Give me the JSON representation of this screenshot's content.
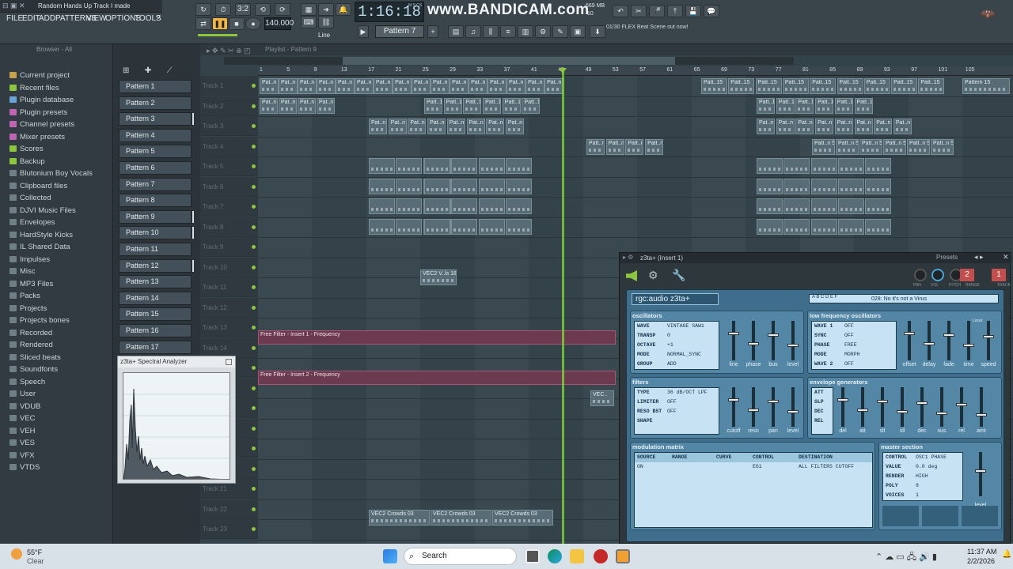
{
  "window": {
    "title": "Random Hands Up Track I made"
  },
  "menu": [
    "FILE",
    "EDIT",
    "ADD",
    "PATTERNS",
    "VIEW",
    "OPTIONS",
    "TOOLS",
    "?"
  ],
  "transport": {
    "time": "1:16:18",
    "time_unit": "M:S:CS",
    "tempo": "140.000",
    "snap": "Line",
    "pattern": "Pattern 7",
    "cpu": "669 MB",
    "cpu2": "10"
  },
  "watermark": "www.BANDICAM.com",
  "hint": {
    "count": "01/30",
    "text": "FLEX Beat Scene out now!"
  },
  "browser": {
    "header": "Browser - All",
    "items": [
      {
        "label": "Current project",
        "color": "#c9a04a"
      },
      {
        "label": "Recent files",
        "color": "#8cc63f"
      },
      {
        "label": "Plugin database",
        "color": "#6aa3d6"
      },
      {
        "label": "Plugin presets",
        "color": "#c064b4"
      },
      {
        "label": "Channel presets",
        "color": "#c064b4"
      },
      {
        "label": "Mixer presets",
        "color": "#c064b4"
      },
      {
        "label": "Scores",
        "color": "#8cc63f"
      },
      {
        "label": "Backup",
        "color": "#8cc63f"
      },
      {
        "label": "Blutonium Boy Vocals",
        "color": "#6f7f88"
      },
      {
        "label": "Clipboard files",
        "color": "#6f7f88"
      },
      {
        "label": "Collected",
        "color": "#6f7f88"
      },
      {
        "label": "DJVI Music Files",
        "color": "#6f7f88"
      },
      {
        "label": "Envelopes",
        "color": "#6f7f88"
      },
      {
        "label": "HardStyle Kicks",
        "color": "#6f7f88"
      },
      {
        "label": "IL Shared Data",
        "color": "#6f7f88"
      },
      {
        "label": "Impulses",
        "color": "#6f7f88"
      },
      {
        "label": "Misc",
        "color": "#6f7f88"
      },
      {
        "label": "MP3 Files",
        "color": "#6f7f88"
      },
      {
        "label": "Packs",
        "color": "#6f7f88"
      },
      {
        "label": "Projects",
        "color": "#6f7f88"
      },
      {
        "label": "Projects bones",
        "color": "#6f7f88"
      },
      {
        "label": "Recorded",
        "color": "#6f7f88"
      },
      {
        "label": "Rendered",
        "color": "#6f7f88"
      },
      {
        "label": "Sliced beats",
        "color": "#6f7f88"
      },
      {
        "label": "Soundfonts",
        "color": "#6f7f88"
      },
      {
        "label": "Speech",
        "color": "#6f7f88"
      },
      {
        "label": "User",
        "color": "#6f7f88"
      },
      {
        "label": "VDUB",
        "color": "#6f7f88"
      },
      {
        "label": "VEC",
        "color": "#6f7f88"
      },
      {
        "label": "VEH",
        "color": "#6f7f88"
      },
      {
        "label": "VES",
        "color": "#6f7f88"
      },
      {
        "label": "VFX",
        "color": "#6f7f88"
      },
      {
        "label": "VTDS",
        "color": "#6f7f88"
      }
    ]
  },
  "patterns": [
    "Pattern 1",
    "Pattern 2",
    "Pattern 3",
    "Pattern 4",
    "Pattern 5",
    "Pattern 6",
    "Pattern 7",
    "Pattern 8",
    "Pattern 9",
    "Pattern 10",
    "Pattern 11",
    "Pattern 12",
    "Pattern 13",
    "Pattern 14",
    "Pattern 15",
    "Pattern 16",
    "Pattern 17"
  ],
  "playlist": {
    "title": "Playlist - Pattern 9",
    "ruler": [
      "1",
      "5",
      "9",
      "13",
      "17",
      "21",
      "25",
      "29",
      "33",
      "37",
      "41",
      "45",
      "49",
      "53",
      "57",
      "61",
      "65",
      "69",
      "73",
      "77",
      "81",
      "85",
      "89",
      "93",
      "97",
      "101",
      "105"
    ],
    "tracks": [
      "Track 1",
      "Track 2",
      "Track 3",
      "Track 4",
      "Track 5",
      "Track 6",
      "Track 7",
      "Track 8",
      "Track 9",
      "Track 10",
      "Track 11",
      "Track 12",
      "Track 13",
      "Track 14",
      "Track 15",
      "Track 16",
      "Track 17",
      "Track 18",
      "Track 19",
      "Track 20",
      "Track 21",
      "Track 22",
      "Track 23"
    ],
    "clip_labels": {
      "pat1": "Pat..n 1",
      "pat2": "Pat..n 2",
      "pat3": "Pat..n 3",
      "pat5": "Patt..n 5",
      "pat10": "Patt..10",
      "pat12": "Pat..12",
      "pat15": "Patt..15",
      "patlast": "Pattern 15",
      "vec": "VEC2 V..ls 18",
      "vec2": "VEC..",
      "ff1": "Free Filter - Insert 1 - Frequency",
      "ff2": "Free Filter - Insert 2 - Frequency",
      "crowd": "VEC2 Crowds 03",
      "tempo": "Tempo"
    }
  },
  "spectral": {
    "title": "z3ta+ Spectral Analyzer"
  },
  "plugin": {
    "title": "z3ta+ (Insert 1)",
    "presets": "Presets",
    "brand": "rgc:audio z3ta+",
    "patch": "028: No it's not a Virus",
    "knobs": [
      "PAN",
      "VOL",
      "PITCH",
      "RANGE",
      "TRACK"
    ],
    "track_num": "1",
    "range_num": "2",
    "osc": {
      "label": "oscillators",
      "rows": [
        [
          "WAVE",
          "VINTAGE SAW1"
        ],
        [
          "TRANSP",
          "0"
        ],
        [
          "OCTAVE",
          "+1"
        ],
        [
          "MODE",
          "NORMAL_SYNC"
        ],
        [
          "GROUP",
          "ADD"
        ]
      ],
      "faders": [
        "fine",
        "phase",
        "bus",
        "level"
      ]
    },
    "lfo": {
      "label": "low frequency oscillators",
      "rows": [
        [
          "WAVE 1",
          "OFF"
        ],
        [
          "SYNC",
          "OFF"
        ],
        [
          "PHASE",
          "FREE"
        ],
        [
          "MODE",
          "MORPH"
        ],
        [
          "WAVE 2",
          "OFF"
        ]
      ],
      "faders": [
        "offset",
        "delay",
        "fade",
        "time",
        "speed"
      ],
      "local": "Local"
    },
    "filters": {
      "label": "filters",
      "rows": [
        [
          "TYPE",
          "36 dB/OCT LPF"
        ],
        [
          "LIMITER",
          "OFF"
        ],
        [
          "RESO BST",
          "OFF"
        ],
        [
          "SHAPE",
          ""
        ]
      ],
      "faders": [
        "cutoff",
        "reso",
        "pan",
        "level"
      ]
    },
    "env": {
      "label": "envelope generators",
      "rows": [
        "ATT",
        "SLP",
        "DEC",
        "REL"
      ],
      "faders": [
        "del",
        "att",
        "slt",
        "sll",
        "dec",
        "sus",
        "rel",
        "amt"
      ]
    },
    "modmatrix": {
      "label": "modulation matrix",
      "headers": [
        "SOURCE",
        "RANGE",
        "CURVE",
        "CONTROL",
        "DESTINATION"
      ],
      "row1": [
        "ON",
        "",
        "",
        "EG1",
        "ALL FILTERS CUTOFF"
      ]
    },
    "master": {
      "label": "master section",
      "rows": [
        [
          "CONTROL",
          "OSC1 PHASE"
        ],
        [
          "VALUE",
          "0.0 deg"
        ],
        [
          "RENDER",
          "HIGH"
        ],
        [
          "POLY",
          "8"
        ],
        [
          "VOICES",
          "1"
        ]
      ],
      "fader": "level"
    }
  },
  "taskbar": {
    "weather_temp": "55°F",
    "weather_desc": "Clear",
    "search": "Search",
    "time": "11:37 AM",
    "date": "2/2/2026"
  }
}
